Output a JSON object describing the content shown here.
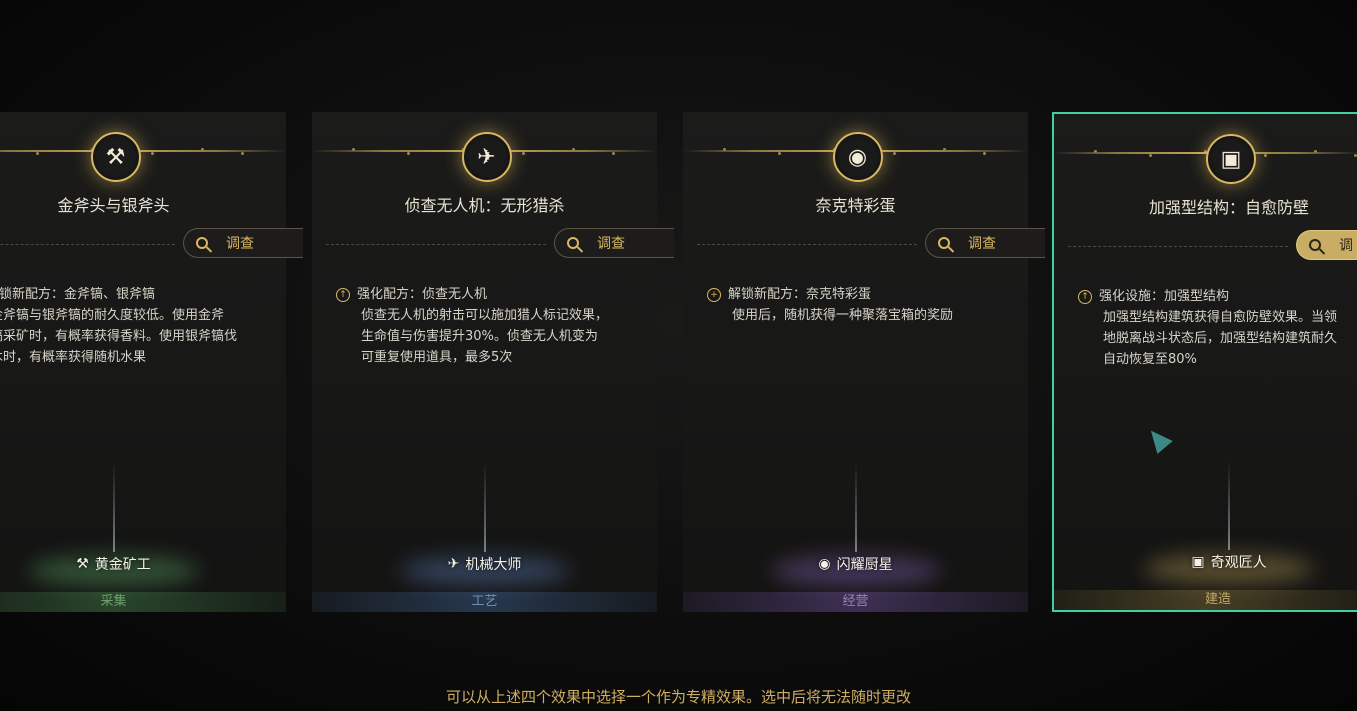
{
  "cards": [
    {
      "title": "金斧头与银斧头",
      "icon": "pickaxe-axe-icon",
      "investigate_label": "调查",
      "effect_icon": "unlock-icon",
      "effect_head": "解锁新配方：金斧镐、银斧镐",
      "effect_lines": [
        "金斧镐与银斧镐的耐久度较低。使用金斧",
        "镐采矿时，有概率获得香料。使用银斧镐伐",
        "木时，有概率获得随机水果"
      ],
      "profession": "黄金矿工",
      "category": "采集",
      "category_color": "#5e8f5f"
    },
    {
      "title": "侦查无人机：无形猎杀",
      "icon": "drone-icon",
      "investigate_label": "调查",
      "effect_icon": "upgrade-icon",
      "effect_head": "强化配方：侦查无人机",
      "effect_lines": [
        "侦查无人机的射击可以施加猎人标记效果，",
        "生命值与伤害提升30%。侦查无人机变为",
        "可重复使用道具，最多5次"
      ],
      "profession": "机械大师",
      "category": "工艺",
      "category_color": "#5c7fa3"
    },
    {
      "title": "奈克特彩蛋",
      "icon": "frying-pan-icon",
      "investigate_label": "调查",
      "effect_icon": "unlock-icon",
      "effect_head": "解锁新配方：奈克特彩蛋",
      "effect_lines": [
        "使用后，随机获得一种聚落宝箱的奖励"
      ],
      "profession": "闪耀厨星",
      "category": "经营",
      "category_color": "#8d6fb4"
    },
    {
      "title": "加强型结构：自愈防壁",
      "icon": "building-shield-icon",
      "investigate_label": "调",
      "effect_icon": "upgrade-icon",
      "effect_head": "强化设施：加强型结构",
      "effect_lines": [
        "加强型结构建筑获得自愈防壁效果。当领",
        "地脱离战斗状态后，加强型结构建筑耐久",
        "自动恢复至80%"
      ],
      "profession": "奇观匠人",
      "category": "建造",
      "category_color": "#b7a25a"
    }
  ],
  "footer_text": "可以从上述四个效果中选择一个作为专精效果。选中后将无法随时更改"
}
